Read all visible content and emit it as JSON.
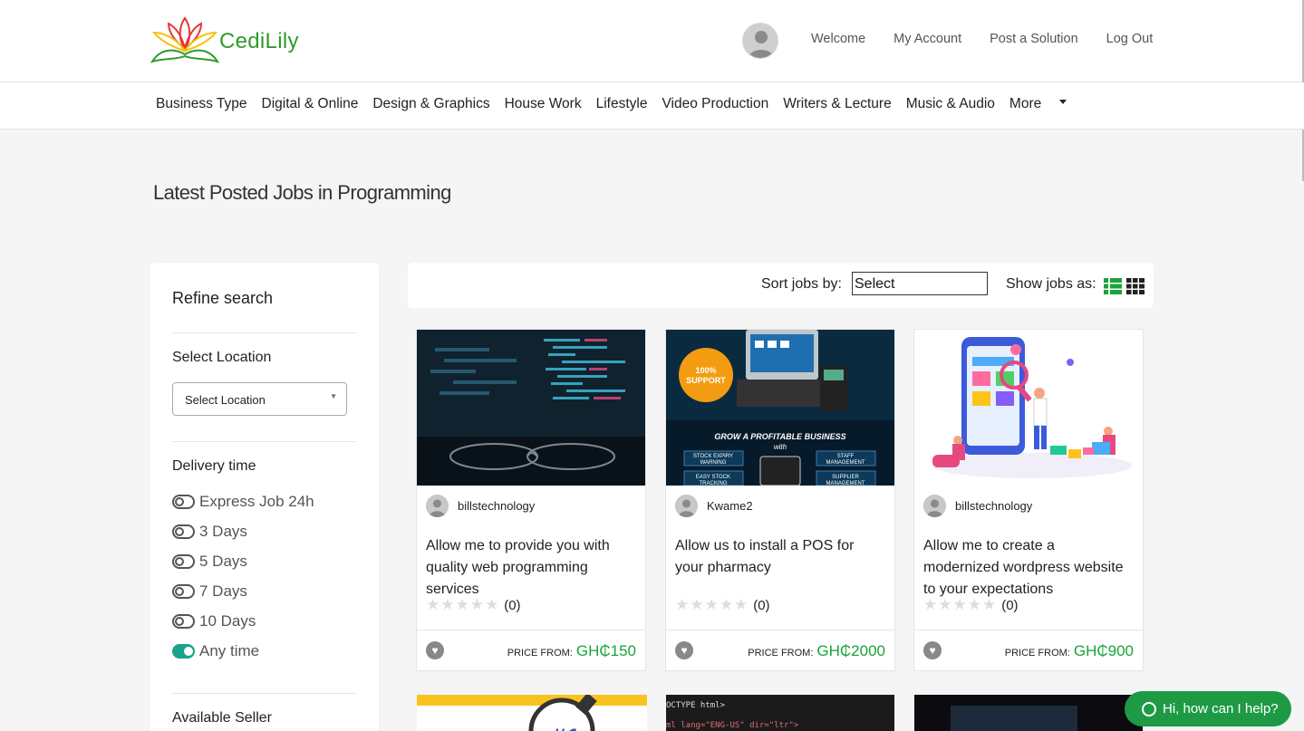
{
  "brand": {
    "name": "CediLily"
  },
  "header": {
    "links": [
      "Welcome",
      "My Account",
      "Post a Solution",
      "Log Out"
    ]
  },
  "categories": [
    "Business Type",
    "Digital & Online",
    "Design & Graphics",
    "House Work",
    "Lifestyle",
    "Video Production",
    "Writers & Lecture",
    "Music & Audio",
    "More"
  ],
  "page": {
    "title": "Latest Posted Jobs in Programming"
  },
  "sidebar": {
    "title": "Refine search",
    "location_label": "Select Location",
    "location_value": "Select Location",
    "delivery_label": "Delivery time",
    "delivery_options": [
      {
        "label": "Express Job 24h",
        "selected": false
      },
      {
        "label": "3 Days",
        "selected": false
      },
      {
        "label": "5 Days",
        "selected": false
      },
      {
        "label": "7 Days",
        "selected": false
      },
      {
        "label": "10 Days",
        "selected": false
      },
      {
        "label": "Any time",
        "selected": true
      }
    ],
    "seller_label": "Available Seller"
  },
  "toolbar": {
    "sort_label": "Sort jobs by:",
    "sort_value": "Select",
    "show_label": "Show jobs as:"
  },
  "jobs": [
    {
      "seller": "billstechnology",
      "title": "Allow me to provide you with quality web programming services",
      "rating_count": "(0)",
      "price_label": "PRICE FROM:",
      "price": "GH₵150"
    },
    {
      "seller": "Kwame2",
      "title": "Allow us to install a POS for your pharmacy",
      "rating_count": "(0)",
      "price_label": "PRICE FROM:",
      "price": "GH₵2000"
    },
    {
      "seller": "billstechnology",
      "title": "Allow me to create a modernized wordpress website to your expectations",
      "rating_count": "(0)",
      "price_label": "PRICE FROM:",
      "price": "GH₵900"
    }
  ],
  "card_images": {
    "pos": {
      "badge": "100% SUPPORT",
      "headline": "GROW A PROFITABLE BUSINESS",
      "sub": "with",
      "left1": "STOCK EXPIRY WARNING",
      "right1": "STAFF MANAGEMENT",
      "left2": "EASY STOCK TRACKING",
      "right2": "SUPPLIER MANAGEMENT"
    },
    "code": {
      "line1": "OCTYPE html>",
      "line2": "ml lang=\"ENG-US\" dir=\"ltr\">"
    }
  },
  "chat": {
    "label": "Hi, how can I help?"
  },
  "colors": {
    "brand_green": "#2e9b2e",
    "price_green": "#1aa33a",
    "toggle_on": "#17a589",
    "chat_green": "#1e9a45"
  }
}
